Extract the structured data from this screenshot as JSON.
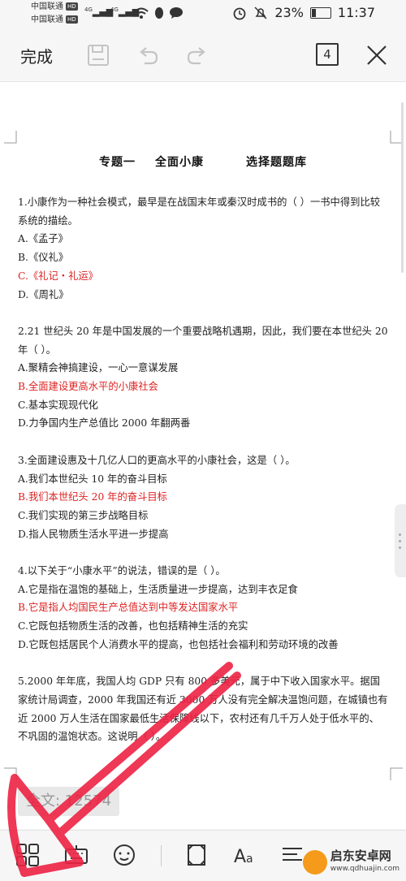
{
  "status_bar": {
    "carrier1": "中国联通",
    "carrier2": "中国联通",
    "hd": "HD",
    "signal1": "4G",
    "signal2": "4G",
    "battery_percent": "23%",
    "battery_level": 0.23,
    "time": "11:37"
  },
  "toolbar": {
    "done_label": "完成",
    "page_count": "4",
    "icons": [
      "save-icon",
      "undo-icon",
      "redo-icon",
      "close-icon"
    ]
  },
  "document": {
    "title_part1": "专题一",
    "title_part2": "全面小康",
    "title_part3": "选择题题库",
    "q1": {
      "question": "1.小康作为一种社会模式，最早是在战国末年或秦汉时成书的（ ）一书中得到比较系统的描绘。",
      "a": "A.《孟子》",
      "b": "B.《仪礼》",
      "c": "C.《礼记・礼运》",
      "d": "D.《周礼》"
    },
    "q2": {
      "question": "2.21 世纪头 20 年是中国发展的一个重要战略机遇期，因此，我们要在本世纪头 20 年（ ）。",
      "a": "A.聚精会神搞建设，一心一意谋发展",
      "b": "B.全面建设更高水平的小康社会",
      "c": "C.基本实现现代化",
      "d": "D.力争国内生产总值比 2000 年翻两番"
    },
    "q3": {
      "question": "3.全面建设惠及十几亿人口的更高水平的小康社会，这是（ ）。",
      "a": "A.我们本世纪头 10 年的奋斗目标",
      "b": "B.我们本世纪头 20 年的奋斗目标",
      "c": "C.我们实现的第三步战略目标",
      "d": "D.指人民物质生活水平进一步提高"
    },
    "q4": {
      "question": "4.以下关于“小康水平”的说法，错误的是（ ）。",
      "a": "A.它是指在温饱的基础上，生活质量进一步提高，达到丰衣足食",
      "b": "B.它是指人均国民生产总值达到中等发达国家水平",
      "c": "C.它既包括物质生活的改善，也包括精神生活的充实",
      "d": "D.它既包括居民个人消费水平的提高，也包括社会福利和劳动环境的改善"
    },
    "q5": {
      "question": "5.2000 年年底，我国人均 GDP 只有 800 多美元，属于中下收入国家水平。据国家统计局调查，2000 年我国还有近 3000 万人没有完全解决温饱问题，在城镇也有近 2000 万人生活在国家最低生活保障线以下，农村还有几千万人处于低水平的、不巩固的温饱状态。这说明（ ）。"
    }
  },
  "word_count": "全文: 12574",
  "bottom_bar": {
    "icons": [
      "grid-icon",
      "keyboard-icon",
      "face-icon",
      "fullscreen-icon",
      "font-size-icon",
      "align-icon"
    ]
  },
  "watermark": {
    "name": "启东安卓网",
    "url": "www.qdhuajin.com"
  },
  "colors": {
    "answer_red": "#d22222",
    "arrow_red": "#ee2244"
  }
}
